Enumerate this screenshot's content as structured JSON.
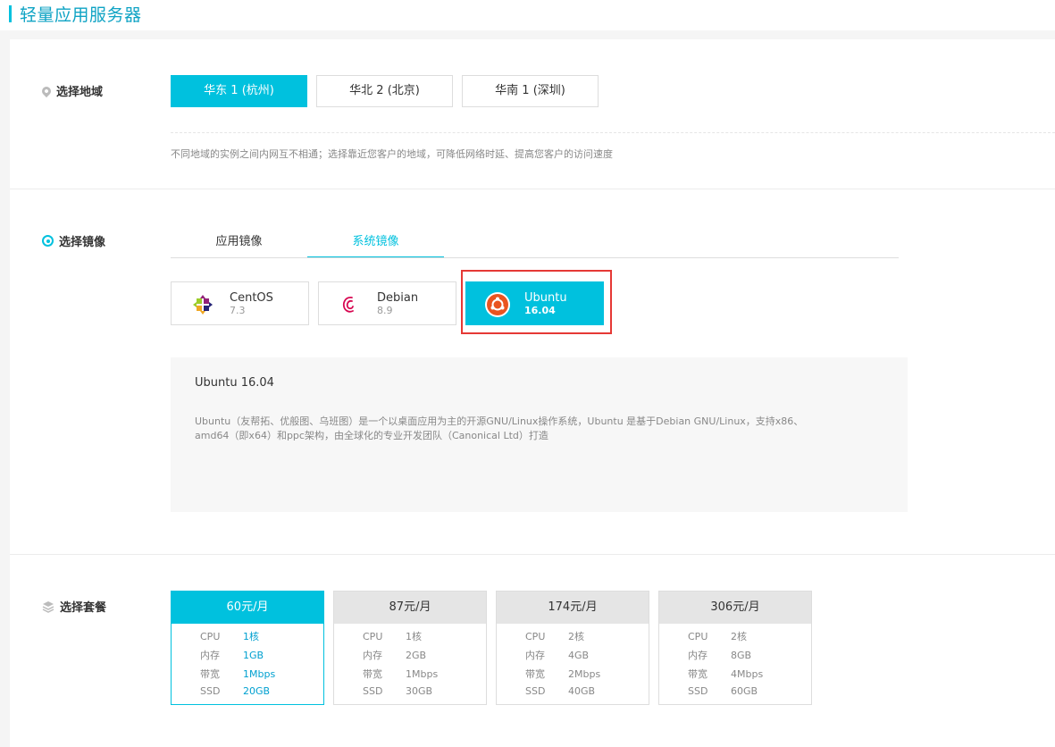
{
  "page": {
    "title": "轻量应用服务器"
  },
  "region": {
    "label": "选择地域",
    "options": [
      "华东 1 (杭州)",
      "华北 2 (北京)",
      "华南 1 (深圳)"
    ],
    "selected": 0,
    "hint": "不同地域的实例之间内网互不相通；选择靠近您客户的地域，可降低网络时延、提高您客户的访问速度"
  },
  "image": {
    "label": "选择镜像",
    "tabs": [
      "应用镜像",
      "系统镜像"
    ],
    "active_tab": 1,
    "os": [
      {
        "name": "CentOS",
        "version": "7.3",
        "icon": "centos-icon"
      },
      {
        "name": "Debian",
        "version": "8.9",
        "icon": "debian-icon"
      },
      {
        "name": "Ubuntu",
        "version": "16.04",
        "icon": "ubuntu-icon"
      }
    ],
    "selected_os": 2,
    "desc_title": "Ubuntu 16.04",
    "desc_text_1": "Ubuntu（友帮拓、优般图、乌班图）是一个以桌面应用为主的开源GNU/Linux操作系统，Ubuntu 是基于Debian GNU/Linux，支持x86、",
    "desc_text_2": "amd64（即x64）和ppc架构，由全球化的专业开发团队（Canonical Ltd）打造"
  },
  "plan": {
    "label": "选择套餐",
    "selected": 0,
    "options": [
      {
        "price": "60元/月",
        "specs": [
          [
            "CPU",
            "1核"
          ],
          [
            "内存",
            "1GB"
          ],
          [
            "带宽",
            "1Mbps"
          ],
          [
            "SSD",
            "20GB"
          ]
        ]
      },
      {
        "price": "87元/月",
        "specs": [
          [
            "CPU",
            "1核"
          ],
          [
            "内存",
            "2GB"
          ],
          [
            "带宽",
            "1Mbps"
          ],
          [
            "SSD",
            "30GB"
          ]
        ]
      },
      {
        "price": "174元/月",
        "specs": [
          [
            "CPU",
            "2核"
          ],
          [
            "内存",
            "4GB"
          ],
          [
            "带宽",
            "2Mbps"
          ],
          [
            "SSD",
            "40GB"
          ]
        ]
      },
      {
        "price": "306元/月",
        "specs": [
          [
            "CPU",
            "2核"
          ],
          [
            "内存",
            "8GB"
          ],
          [
            "带宽",
            "4Mbps"
          ],
          [
            "SSD",
            "60GB"
          ]
        ]
      }
    ]
  },
  "colors": {
    "accent": "#00c1de",
    "highlight": "#e53935"
  }
}
